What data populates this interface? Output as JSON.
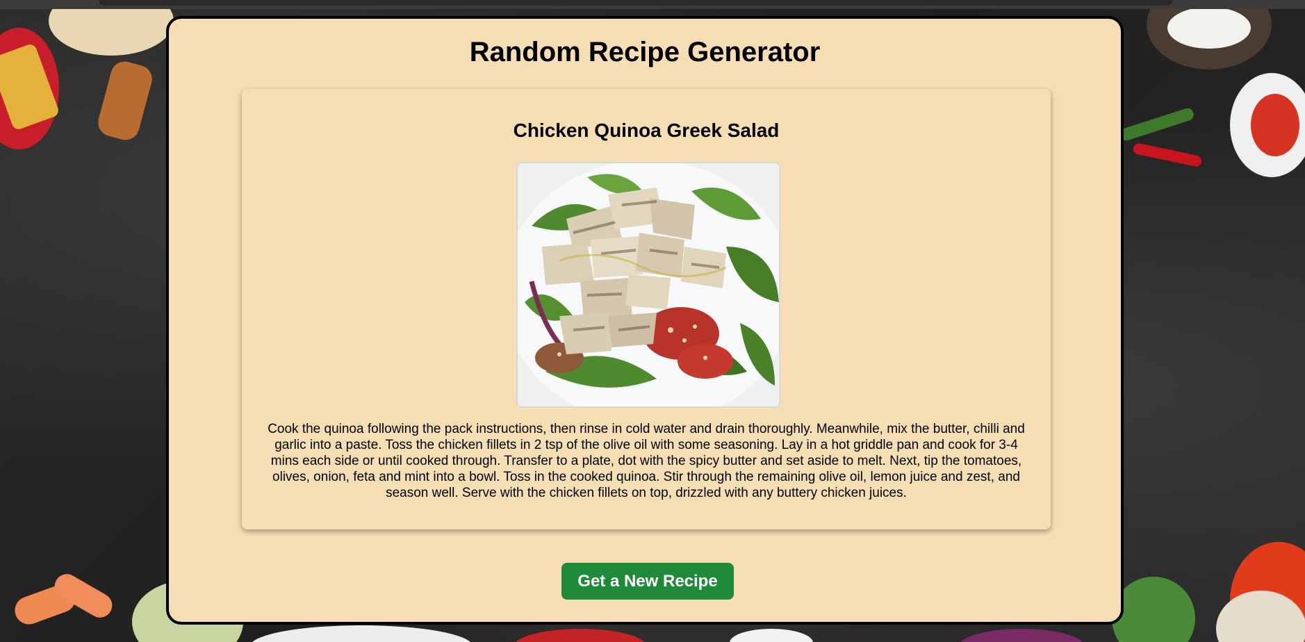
{
  "page": {
    "title": "Random Recipe Generator"
  },
  "recipe": {
    "name": "Chicken Quinoa Greek Salad",
    "image_alt": "Chicken Quinoa Greek Salad",
    "instructions": "Cook the quinoa following the pack instructions, then rinse in cold water and drain thoroughly. Meanwhile, mix the butter, chilli and garlic into a paste. Toss the chicken fillets in 2 tsp of the olive oil with some seasoning. Lay in a hot griddle pan and cook for 3-4 mins each side or until cooked through. Transfer to a plate, dot with the spicy butter and set aside to melt. Next, tip the tomatoes, olives, onion, feta and mint into a bowl. Toss in the cooked quinoa. Stir through the remaining olive oil, lemon juice and zest, and season well. Serve with the chicken fillets on top, drizzled with any buttery chicken juices."
  },
  "actions": {
    "new_recipe_label": "Get a New Recipe"
  },
  "colors": {
    "panel_background": "#f5deb3",
    "button_background": "#1e8a3a",
    "page_background": "#262626"
  }
}
